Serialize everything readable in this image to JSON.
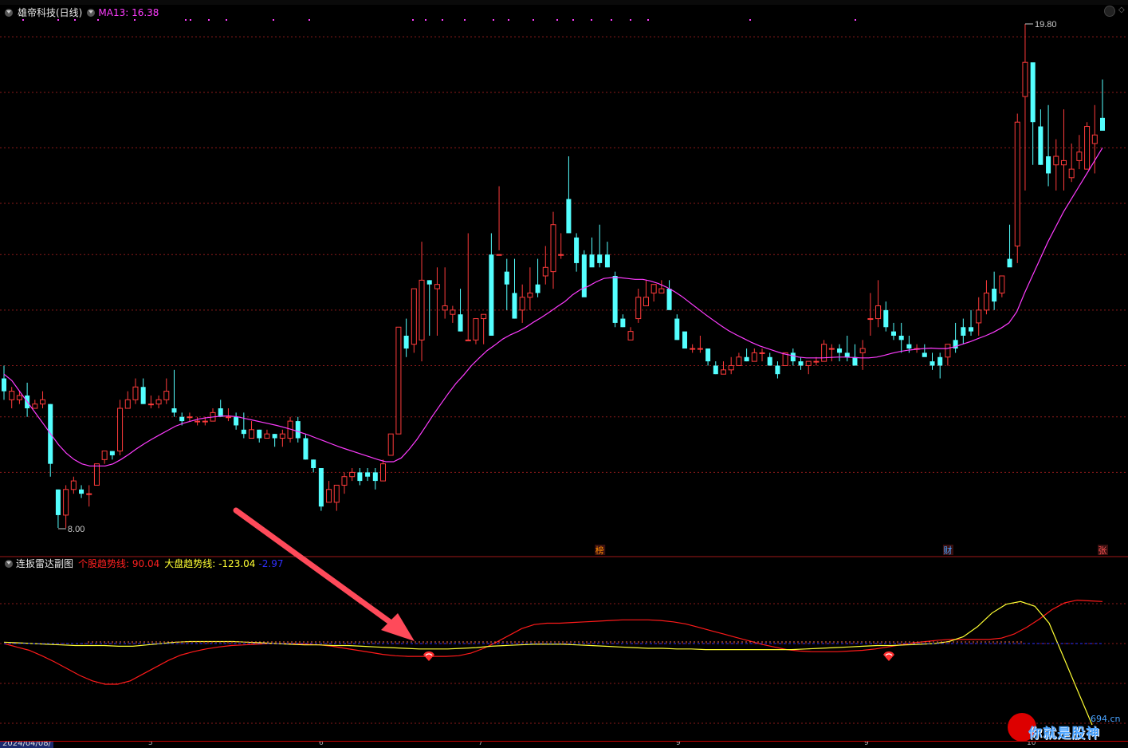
{
  "main_chart": {
    "stock_title": "雄帝科技(日线)",
    "ma_label": "MA13: 16.38",
    "high_label": "19.80",
    "low_label": "8.00",
    "price_range": [
      8.0,
      19.8
    ],
    "event_markers": [
      "榜",
      "财",
      "张"
    ]
  },
  "indicator": {
    "title": "连扳雷达副图",
    "line1_label": "个股趋势线: 90.04",
    "line2_label": "大盘趋势线: -123.04",
    "line3_label": "-2.97"
  },
  "time_axis": {
    "start_date": "2024/04/08/",
    "month_marks": [
      "5",
      "6",
      "7",
      "9",
      "9",
      "10"
    ]
  },
  "watermark": {
    "url": "694.cn",
    "text": "你就是股神"
  },
  "colors": {
    "up": "#ff3b3b",
    "down": "#54ffff",
    "ma": "#ff3cff",
    "stock_trend": "#ff1a1a",
    "market_trend": "#ffff33",
    "zero_line": "#3030ff",
    "grid": "#8b1a1a"
  },
  "chart_data": {
    "type": "candlestick",
    "ma_period": 13,
    "candles": [
      [
        11.5,
        11.8,
        11.0,
        11.2
      ],
      [
        11.0,
        11.3,
        10.8,
        11.2
      ],
      [
        11.0,
        11.2,
        10.9,
        11.1
      ],
      [
        11.1,
        11.4,
        10.6,
        10.8
      ],
      [
        10.8,
        11.0,
        10.8,
        10.9
      ],
      [
        10.9,
        11.2,
        10.8,
        11.0
      ],
      [
        10.9,
        10.9,
        9.2,
        9.5
      ],
      [
        8.9,
        8.9,
        8.0,
        8.3
      ],
      [
        8.3,
        9.0,
        8.0,
        8.9
      ],
      [
        8.9,
        9.2,
        8.8,
        9.1
      ],
      [
        8.9,
        9.0,
        8.7,
        8.8
      ],
      [
        8.8,
        9.0,
        8.5,
        8.8
      ],
      [
        9.0,
        9.5,
        9.0,
        9.5
      ],
      [
        9.6,
        9.8,
        9.5,
        9.8
      ],
      [
        9.8,
        9.8,
        9.6,
        9.7
      ],
      [
        9.8,
        11.0,
        9.7,
        10.8
      ],
      [
        10.8,
        11.2,
        10.8,
        11.0
      ],
      [
        11.0,
        11.5,
        10.9,
        11.3
      ],
      [
        11.3,
        11.5,
        10.9,
        10.9
      ],
      [
        10.9,
        11.1,
        10.8,
        10.9
      ],
      [
        10.9,
        11.1,
        10.8,
        11.0
      ],
      [
        11.0,
        11.5,
        10.9,
        11.2
      ],
      [
        10.8,
        11.7,
        10.6,
        10.7
      ],
      [
        10.6,
        10.7,
        10.4,
        10.5
      ],
      [
        10.6,
        10.7,
        10.5,
        10.6
      ],
      [
        10.5,
        10.6,
        10.4,
        10.5
      ],
      [
        10.5,
        10.6,
        10.4,
        10.5
      ],
      [
        10.5,
        10.8,
        10.5,
        10.7
      ],
      [
        10.8,
        11.0,
        10.6,
        10.6
      ],
      [
        10.6,
        10.8,
        10.5,
        10.6
      ],
      [
        10.6,
        10.7,
        10.3,
        10.4
      ],
      [
        10.3,
        10.7,
        10.1,
        10.2
      ],
      [
        10.1,
        10.5,
        10.1,
        10.3
      ],
      [
        10.3,
        10.3,
        10.0,
        10.1
      ],
      [
        10.1,
        10.3,
        10.1,
        10.2
      ],
      [
        10.2,
        10.2,
        9.9,
        10.1
      ],
      [
        10.1,
        10.3,
        9.9,
        10.2
      ],
      [
        10.1,
        10.6,
        10.0,
        10.5
      ],
      [
        10.5,
        10.6,
        10.0,
        10.1
      ],
      [
        10.1,
        10.2,
        9.6,
        9.6
      ],
      [
        9.6,
        9.6,
        9.3,
        9.4
      ],
      [
        9.4,
        9.4,
        8.4,
        8.5
      ],
      [
        8.6,
        9.1,
        8.6,
        8.9
      ],
      [
        8.6,
        9.0,
        8.4,
        9.0
      ],
      [
        9.0,
        9.3,
        8.8,
        9.2
      ],
      [
        9.2,
        9.4,
        9.1,
        9.3
      ],
      [
        9.3,
        9.4,
        9.0,
        9.1
      ],
      [
        9.3,
        9.4,
        9.1,
        9.2
      ],
      [
        9.3,
        9.4,
        8.9,
        9.1
      ],
      [
        9.1,
        9.6,
        9.1,
        9.5
      ],
      [
        9.7,
        10.2,
        9.7,
        10.2
      ],
      [
        10.2,
        12.7,
        10.2,
        12.7
      ],
      [
        12.5,
        12.9,
        12.0,
        12.2
      ],
      [
        12.3,
        13.6,
        12.1,
        13.6
      ],
      [
        12.4,
        14.7,
        11.9,
        13.8
      ],
      [
        13.8,
        13.8,
        12.5,
        13.7
      ],
      [
        13.6,
        14.1,
        12.5,
        13.7
      ],
      [
        13.1,
        14.1,
        12.9,
        13.2
      ],
      [
        13.0,
        13.2,
        12.8,
        13.1
      ],
      [
        13.0,
        13.6,
        12.6,
        12.6
      ],
      [
        12.4,
        14.9,
        12.4,
        12.4
      ],
      [
        12.4,
        12.9,
        12.3,
        12.9
      ],
      [
        12.9,
        12.9,
        12.3,
        13.0
      ],
      [
        14.4,
        14.9,
        12.5,
        12.5
      ],
      [
        14.4,
        16.0,
        14.5,
        14.4
      ],
      [
        14.0,
        14.3,
        13.1,
        13.7
      ],
      [
        13.5,
        14.3,
        12.9,
        12.9
      ],
      [
        13.1,
        13.7,
        12.8,
        13.4
      ],
      [
        13.4,
        14.1,
        13.1,
        13.5
      ],
      [
        13.7,
        14.3,
        13.4,
        13.5
      ],
      [
        13.9,
        14.6,
        13.7,
        14.1
      ],
      [
        14.0,
        15.4,
        13.6,
        15.1
      ],
      [
        14.4,
        14.9,
        14.3,
        14.4
      ],
      [
        15.7,
        16.7,
        15.1,
        14.9
      ],
      [
        14.8,
        14.9,
        14.0,
        14.2
      ],
      [
        14.4,
        14.5,
        13.6,
        13.4
      ],
      [
        14.4,
        14.8,
        14.3,
        14.1
      ],
      [
        14.4,
        15.1,
        14.1,
        14.2
      ],
      [
        14.4,
        14.7,
        14.1,
        14.1
      ],
      [
        13.9,
        14.0,
        12.7,
        12.8
      ],
      [
        12.9,
        13.0,
        12.7,
        12.7
      ],
      [
        12.4,
        12.7,
        12.4,
        12.6
      ],
      [
        12.9,
        13.6,
        12.8,
        13.4
      ],
      [
        13.2,
        13.8,
        13.2,
        13.4
      ],
      [
        13.5,
        13.7,
        13.3,
        13.7
      ],
      [
        13.5,
        13.8,
        13.5,
        13.6
      ],
      [
        13.6,
        13.8,
        13.2,
        13.1
      ],
      [
        12.9,
        13.0,
        12.4,
        12.4
      ],
      [
        12.6,
        12.4,
        12.3,
        12.2
      ],
      [
        12.2,
        12.3,
        12.1,
        12.2
      ],
      [
        12.2,
        12.5,
        12.1,
        12.2
      ],
      [
        12.2,
        12.2,
        11.8,
        11.9
      ],
      [
        11.8,
        11.9,
        11.6,
        11.6
      ],
      [
        11.6,
        11.9,
        11.7,
        11.7
      ],
      [
        11.7,
        12.0,
        11.6,
        11.8
      ],
      [
        11.8,
        12.1,
        11.8,
        12.0
      ],
      [
        12.0,
        12.2,
        11.9,
        11.9
      ],
      [
        11.9,
        12.2,
        11.9,
        12.1
      ],
      [
        12.1,
        12.2,
        11.9,
        12.1
      ],
      [
        12.0,
        12.1,
        11.8,
        11.8
      ],
      [
        11.8,
        11.9,
        11.5,
        11.6
      ],
      [
        11.8,
        12.1,
        11.9,
        12.1
      ],
      [
        12.1,
        12.2,
        11.8,
        11.9
      ],
      [
        11.9,
        12.0,
        11.7,
        11.8
      ],
      [
        11.8,
        11.9,
        11.6,
        11.9
      ],
      [
        11.9,
        12.0,
        11.8,
        11.9
      ],
      [
        11.9,
        12.4,
        11.9,
        12.3
      ],
      [
        12.2,
        12.3,
        11.9,
        12.2
      ],
      [
        12.2,
        12.3,
        11.9,
        12.1
      ],
      [
        12.1,
        12.5,
        11.9,
        12.0
      ],
      [
        12.0,
        12.3,
        11.9,
        11.8
      ],
      [
        12.1,
        12.4,
        11.7,
        12.2
      ],
      [
        12.9,
        13.5,
        12.5,
        12.9
      ],
      [
        12.9,
        13.8,
        12.7,
        13.2
      ],
      [
        13.1,
        13.3,
        12.6,
        12.7
      ],
      [
        12.6,
        12.8,
        12.4,
        12.5
      ],
      [
        12.5,
        12.8,
        12.1,
        12.4
      ],
      [
        12.3,
        12.5,
        12.1,
        12.2
      ],
      [
        12.2,
        12.3,
        12.1,
        12.2
      ],
      [
        12.1,
        12.3,
        12.1,
        12.0
      ],
      [
        11.9,
        12.1,
        11.7,
        11.8
      ],
      [
        12.0,
        12.1,
        11.5,
        11.8
      ],
      [
        12.0,
        12.3,
        11.8,
        12.3
      ],
      [
        12.4,
        12.8,
        12.1,
        12.2
      ],
      [
        12.7,
        12.9,
        12.3,
        12.5
      ],
      [
        12.7,
        13.1,
        12.5,
        12.6
      ],
      [
        12.8,
        13.4,
        12.5,
        13.1
      ],
      [
        13.1,
        13.8,
        13.0,
        13.5
      ],
      [
        13.6,
        14.0,
        13.1,
        13.3
      ],
      [
        13.5,
        13.9,
        13.4,
        13.9
      ],
      [
        14.3,
        15.1,
        14.2,
        14.1
      ],
      [
        14.6,
        17.7,
        14.2,
        17.5
      ],
      [
        18.1,
        19.8,
        15.9,
        18.9
      ],
      [
        18.9,
        18.2,
        16.5,
        17.5
      ],
      [
        17.4,
        17.8,
        16.5,
        16.5
      ],
      [
        16.7,
        17.9,
        16.0,
        16.3
      ],
      [
        16.5,
        17.1,
        15.9,
        16.7
      ],
      [
        16.5,
        17.8,
        15.9,
        16.6
      ],
      [
        16.2,
        17.0,
        16.1,
        16.4
      ],
      [
        16.6,
        17.2,
        16.4,
        16.8
      ],
      [
        16.4,
        17.5,
        16.4,
        17.4
      ],
      [
        17.0,
        17.9,
        16.3,
        17.2
      ],
      [
        17.6,
        18.5,
        17.4,
        17.3
      ]
    ],
    "ma13": [
      11.6,
      11.45,
      11.2,
      10.95,
      10.7,
      10.45,
      10.2,
      9.95,
      9.75,
      9.6,
      9.5,
      9.45,
      9.45,
      9.45,
      9.5,
      9.6,
      9.72,
      9.85,
      9.97,
      10.08,
      10.18,
      10.28,
      10.38,
      10.45,
      10.5,
      10.55,
      10.58,
      10.6,
      10.62,
      10.62,
      10.6,
      10.56,
      10.52,
      10.48,
      10.44,
      10.4,
      10.35,
      10.3,
      10.24,
      10.18,
      10.11,
      10.04,
      9.97,
      9.9,
      9.84,
      9.78,
      9.72,
      9.66,
      9.6,
      9.55,
      9.55,
      9.64,
      9.84,
      10.07,
      10.34,
      10.62,
      10.88,
      11.14,
      11.38,
      11.58,
      11.8,
      11.98,
      12.15,
      12.28,
      12.42,
      12.52,
      12.6,
      12.7,
      12.82,
      12.93,
      13.05,
      13.18,
      13.3,
      13.46,
      13.58,
      13.66,
      13.76,
      13.84,
      13.86,
      13.86,
      13.84,
      13.82,
      13.82,
      13.78,
      13.72,
      13.64,
      13.54,
      13.42,
      13.28,
      13.14,
      13.0,
      12.87,
      12.74,
      12.62,
      12.52,
      12.43,
      12.34,
      12.26,
      12.2,
      12.14,
      12.08,
      12.04,
      12.0,
      11.98,
      11.98,
      11.98,
      11.99,
      12.0,
      12.0,
      11.99,
      11.98,
      11.98,
      12.0,
      12.04,
      12.09,
      12.13,
      12.16,
      12.18,
      12.2,
      12.21,
      12.2,
      12.2,
      12.24,
      12.3,
      12.36,
      12.43,
      12.5,
      12.58,
      12.68,
      12.8,
      13.06,
      13.5,
      13.9,
      14.3,
      14.7,
      15.05,
      15.4,
      15.7,
      16.0,
      16.3,
      16.6,
      16.9
    ],
    "stock_trend": [
      0,
      -5,
      -10,
      -18,
      -27,
      -37,
      -47,
      -55,
      -60,
      -60,
      -55,
      -45,
      -35,
      -25,
      -17,
      -12,
      -8,
      -5,
      -3,
      -2,
      -1,
      0,
      0,
      0,
      -1,
      -2,
      -4,
      -7,
      -10,
      -13,
      -16,
      -18,
      -19,
      -19,
      -19,
      -19,
      -18,
      -14,
      -7,
      2,
      12,
      22,
      28,
      30,
      30,
      31,
      32,
      33,
      34,
      35,
      35,
      35,
      34,
      32,
      29,
      24,
      19,
      14,
      9,
      4,
      -1,
      -5,
      -9,
      -11,
      -12,
      -12,
      -12,
      -11,
      -10,
      -8,
      -5,
      -2,
      1,
      3,
      5,
      6,
      6,
      6,
      6,
      8,
      14,
      24,
      36,
      50,
      60,
      64,
      63,
      62
    ],
    "market_trend": [
      2,
      1,
      0,
      -1,
      -2,
      -3,
      -3,
      -3,
      -4,
      -4,
      -2,
      0,
      2,
      3,
      3,
      3,
      3,
      2,
      1,
      0,
      -1,
      -2,
      -2,
      -3,
      -3,
      -4,
      -5,
      -6,
      -7,
      -8,
      -8,
      -8,
      -7,
      -6,
      -4,
      -3,
      -2,
      -1,
      -1,
      -1,
      -2,
      -3,
      -4,
      -5,
      -6,
      -7,
      -7,
      -8,
      -8,
      -9,
      -9,
      -9,
      -9,
      -9,
      -9,
      -9,
      -8,
      -7,
      -6,
      -5,
      -4,
      -3,
      -3,
      -2,
      -1,
      0,
      3,
      10,
      25,
      45,
      58,
      62,
      55,
      30,
      -20,
      -70,
      -120
    ],
    "grid_levels": [
      8.0,
      9.3,
      10.6,
      11.8,
      13.1,
      14.4,
      15.6,
      16.9,
      18.2,
      19.5
    ],
    "signal_markers": [
      72,
      148
    ]
  }
}
